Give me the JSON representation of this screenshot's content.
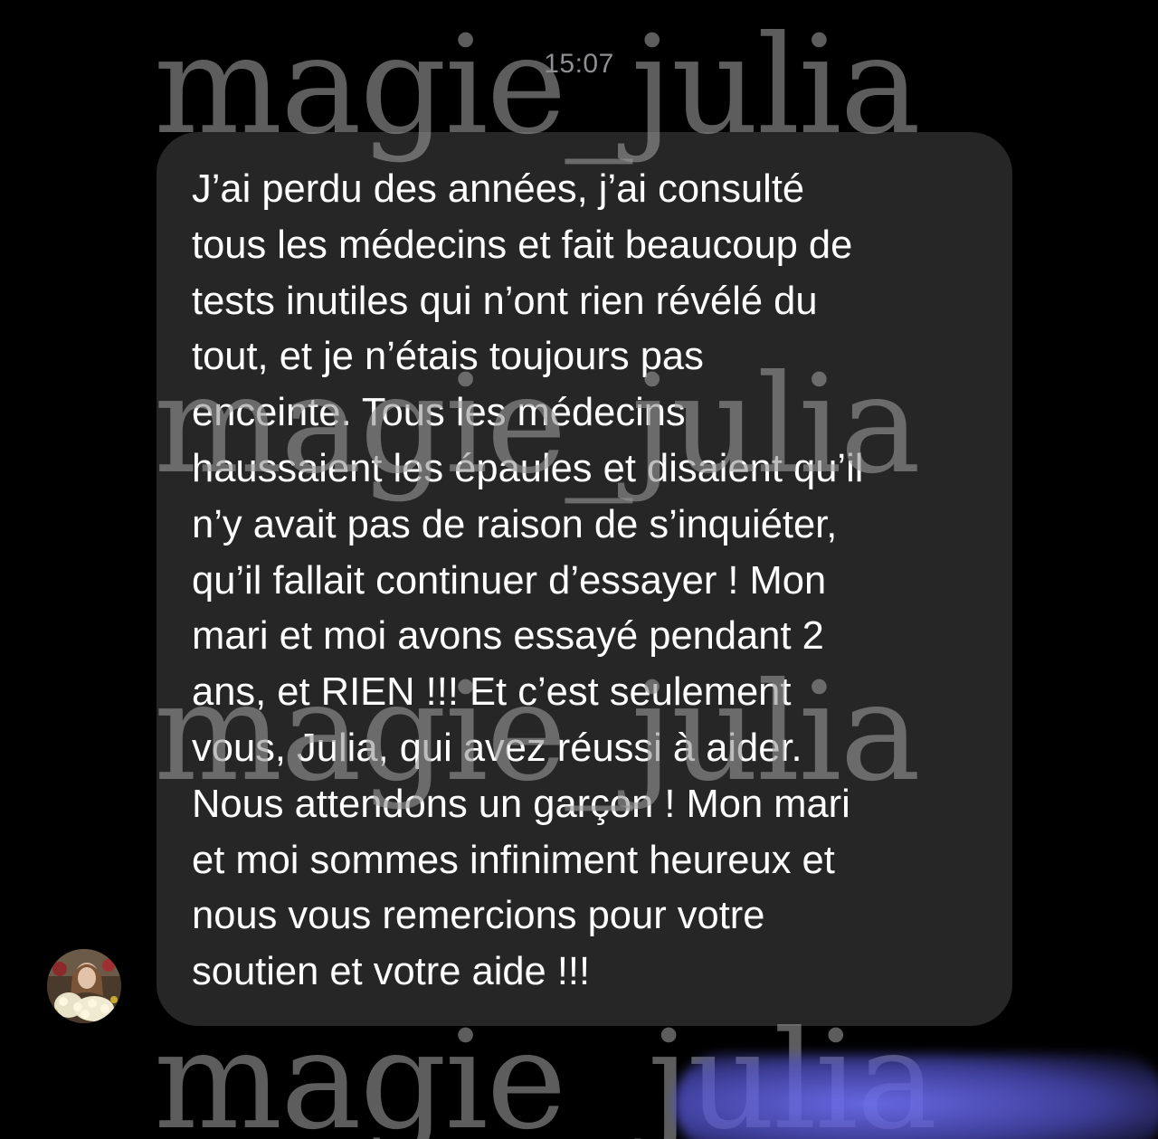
{
  "conversation": {
    "timestamp": "15:07",
    "message": {
      "text": "J’ai perdu des années, j’ai consulté\ntous les médecins et fait beaucoup de\ntests inutiles qui n’ont rien révélé du\ntout, et je n’étais toujours pas\nenceinte. Tous les médecins\nhaussaient les épaules et disaient qu’il\nn’y avait pas de raison de s’inquiéter,\nqu’il fallait continuer d’essayer ! Mon\nmari et moi avons essayé pendant 2\nans, et RIEN !!! Et c’est seulement\nvous, Julia, qui avez réussi à aider.\nNous attendons un garçon ! Mon mari\net moi sommes infiniment heureux et\nnous vous remercions pour votre\nsoutien et votre aide !!!"
    },
    "sender_avatar_icon": "profile-photo"
  },
  "watermark": {
    "text": "magie_julia",
    "text_bottom": "magie  julia"
  },
  "colors": {
    "background": "#000000",
    "bubble": "#262626",
    "message_text": "#ffffff",
    "timestamp": "#8e8e93",
    "watermark": "#969696",
    "blur_overlay": "#6e6ef0"
  }
}
